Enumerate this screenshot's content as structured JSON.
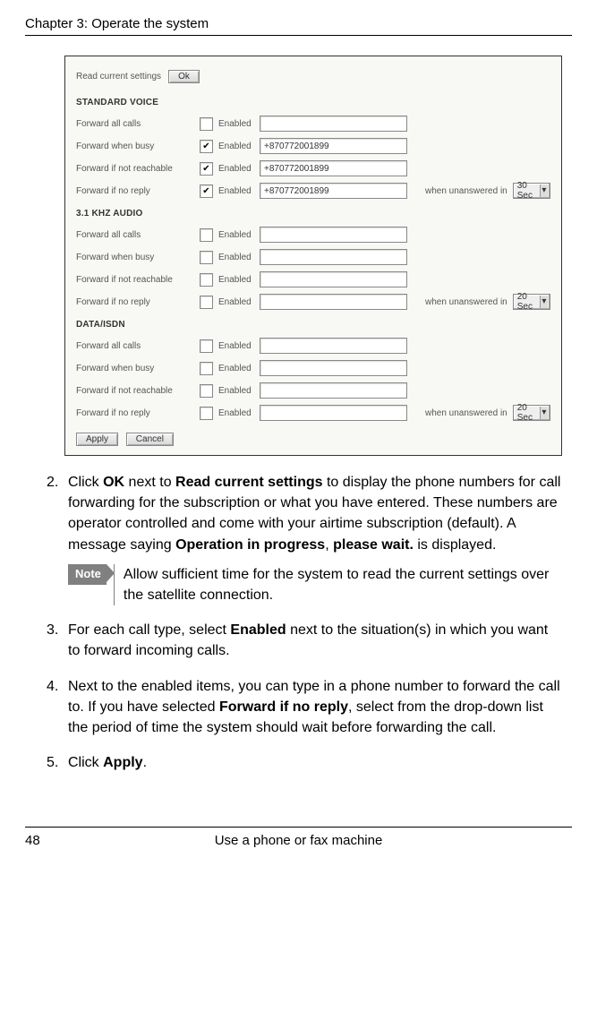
{
  "header": {
    "chapter": "Chapter 3:  Operate the system"
  },
  "screenshot": {
    "read_label": "Read current settings",
    "ok_label": "Ok",
    "enabled_label": "Enabled",
    "when_label": "when unanswered in",
    "default_timeout": "30 Sec",
    "apply_label": "Apply",
    "cancel_label": "Cancel",
    "sections": [
      {
        "title": "STANDARD VOICE",
        "rows": [
          {
            "label": "Forward all calls",
            "checked": false,
            "value": "",
            "has_timeout": false
          },
          {
            "label": "Forward when busy",
            "checked": true,
            "value": "+870772001899",
            "has_timeout": false
          },
          {
            "label": "Forward if not reachable",
            "checked": true,
            "value": "+870772001899",
            "has_timeout": false
          },
          {
            "label": "Forward if no reply",
            "checked": true,
            "value": "+870772001899",
            "has_timeout": true,
            "timeout": "30 Sec"
          }
        ]
      },
      {
        "title": "3.1 KHZ AUDIO",
        "rows": [
          {
            "label": "Forward all calls",
            "checked": false,
            "value": "",
            "has_timeout": false
          },
          {
            "label": "Forward when busy",
            "checked": false,
            "value": "",
            "has_timeout": false
          },
          {
            "label": "Forward if not reachable",
            "checked": false,
            "value": "",
            "has_timeout": false
          },
          {
            "label": "Forward if no reply",
            "checked": false,
            "value": "",
            "has_timeout": true,
            "timeout": "20 Sec"
          }
        ]
      },
      {
        "title": "DATA/ISDN",
        "rows": [
          {
            "label": "Forward all calls",
            "checked": false,
            "value": "",
            "has_timeout": false
          },
          {
            "label": "Forward when busy",
            "checked": false,
            "value": "",
            "has_timeout": false
          },
          {
            "label": "Forward if not reachable",
            "checked": false,
            "value": "",
            "has_timeout": false
          },
          {
            "label": "Forward if no reply",
            "checked": false,
            "value": "",
            "has_timeout": true,
            "timeout": "20 Sec"
          }
        ]
      }
    ]
  },
  "steps": {
    "s2_num": "2.",
    "s2_a": "Click ",
    "s2_b": "OK",
    "s2_c": " next to ",
    "s2_d": "Read current settings",
    "s2_e": " to display the phone numbers for call forwarding for the subscription or what you have entered. These numbers are operator controlled and come with your airtime subscription (default). A message saying ",
    "s2_f": "Operation in progress",
    "s2_g": ", ",
    "s2_h": "please wait.",
    "s2_i": " is displayed.",
    "note_label": "Note",
    "note_text": "Allow sufficient time for the system to read the current settings over the satellite connection.",
    "s3_num": "3.",
    "s3_a": "For each call type, select ",
    "s3_b": "Enabled",
    "s3_c": " next to the situation(s) in which you want to forward incoming calls.",
    "s4_num": "4.",
    "s4_a": "Next to the enabled items, you can type in a phone number to forward the call to. If you have selected ",
    "s4_b": "Forward if no reply",
    "s4_c": ", select from the drop-down list the period of time the system should wait before forwarding the call.",
    "s5_num": "5.",
    "s5_a": "Click ",
    "s5_b": "Apply",
    "s5_c": "."
  },
  "footer": {
    "page": "48",
    "title": "Use a phone or fax machine"
  }
}
